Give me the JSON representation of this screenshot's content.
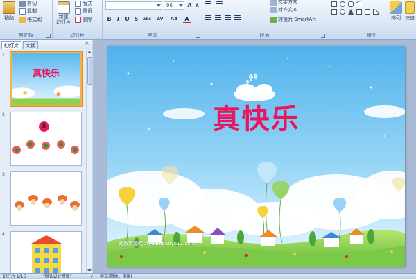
{
  "ribbon": {
    "clipboard": {
      "label": "剪贴板",
      "paste": "粘贴",
      "cut": "剪切",
      "copy": "复制",
      "format_painter": "格式刷"
    },
    "slides": {
      "label": "幻灯片",
      "new_slide_l1": "新建",
      "new_slide_l2": "幻灯片",
      "layout": "版式",
      "reset": "重设",
      "delete": "删除"
    },
    "font": {
      "label": "字体",
      "font_name": "",
      "font_size": "96",
      "bold": "B",
      "italic": "I",
      "underline": "U",
      "strike": "S",
      "shadow": "abc",
      "spacing": "AV",
      "case": "Aa",
      "color": "A"
    },
    "paragraph": {
      "label": "段落",
      "text_direction": "文字方向",
      "align_text": "对齐文本",
      "smartart": "转换为 SmartArt"
    },
    "drawing": {
      "label": "绘图",
      "arrange": "排列",
      "quick_styles": "快速"
    }
  },
  "left_pane": {
    "tab_slides": "幻灯片",
    "tab_outline": "大纲",
    "close": "×",
    "thumbnails": [
      {
        "number": "1",
        "title": "真快乐"
      },
      {
        "number": "2",
        "badge": "5"
      },
      {
        "number": "3"
      },
      {
        "number": "4"
      }
    ]
  },
  "slide": {
    "title": "真快乐",
    "watermark": "幼教资源网 ziyuan.baby611.com"
  },
  "status": {
    "slide_count": "幻灯片 1/16",
    "theme": "\"默认设计模板\"",
    "language": "中文(简体，中国)"
  },
  "colors": {
    "title": "#e8155f",
    "sky_top": "#5ab9ee",
    "grass": "#8fd14f",
    "selection": "#f0b24a"
  }
}
